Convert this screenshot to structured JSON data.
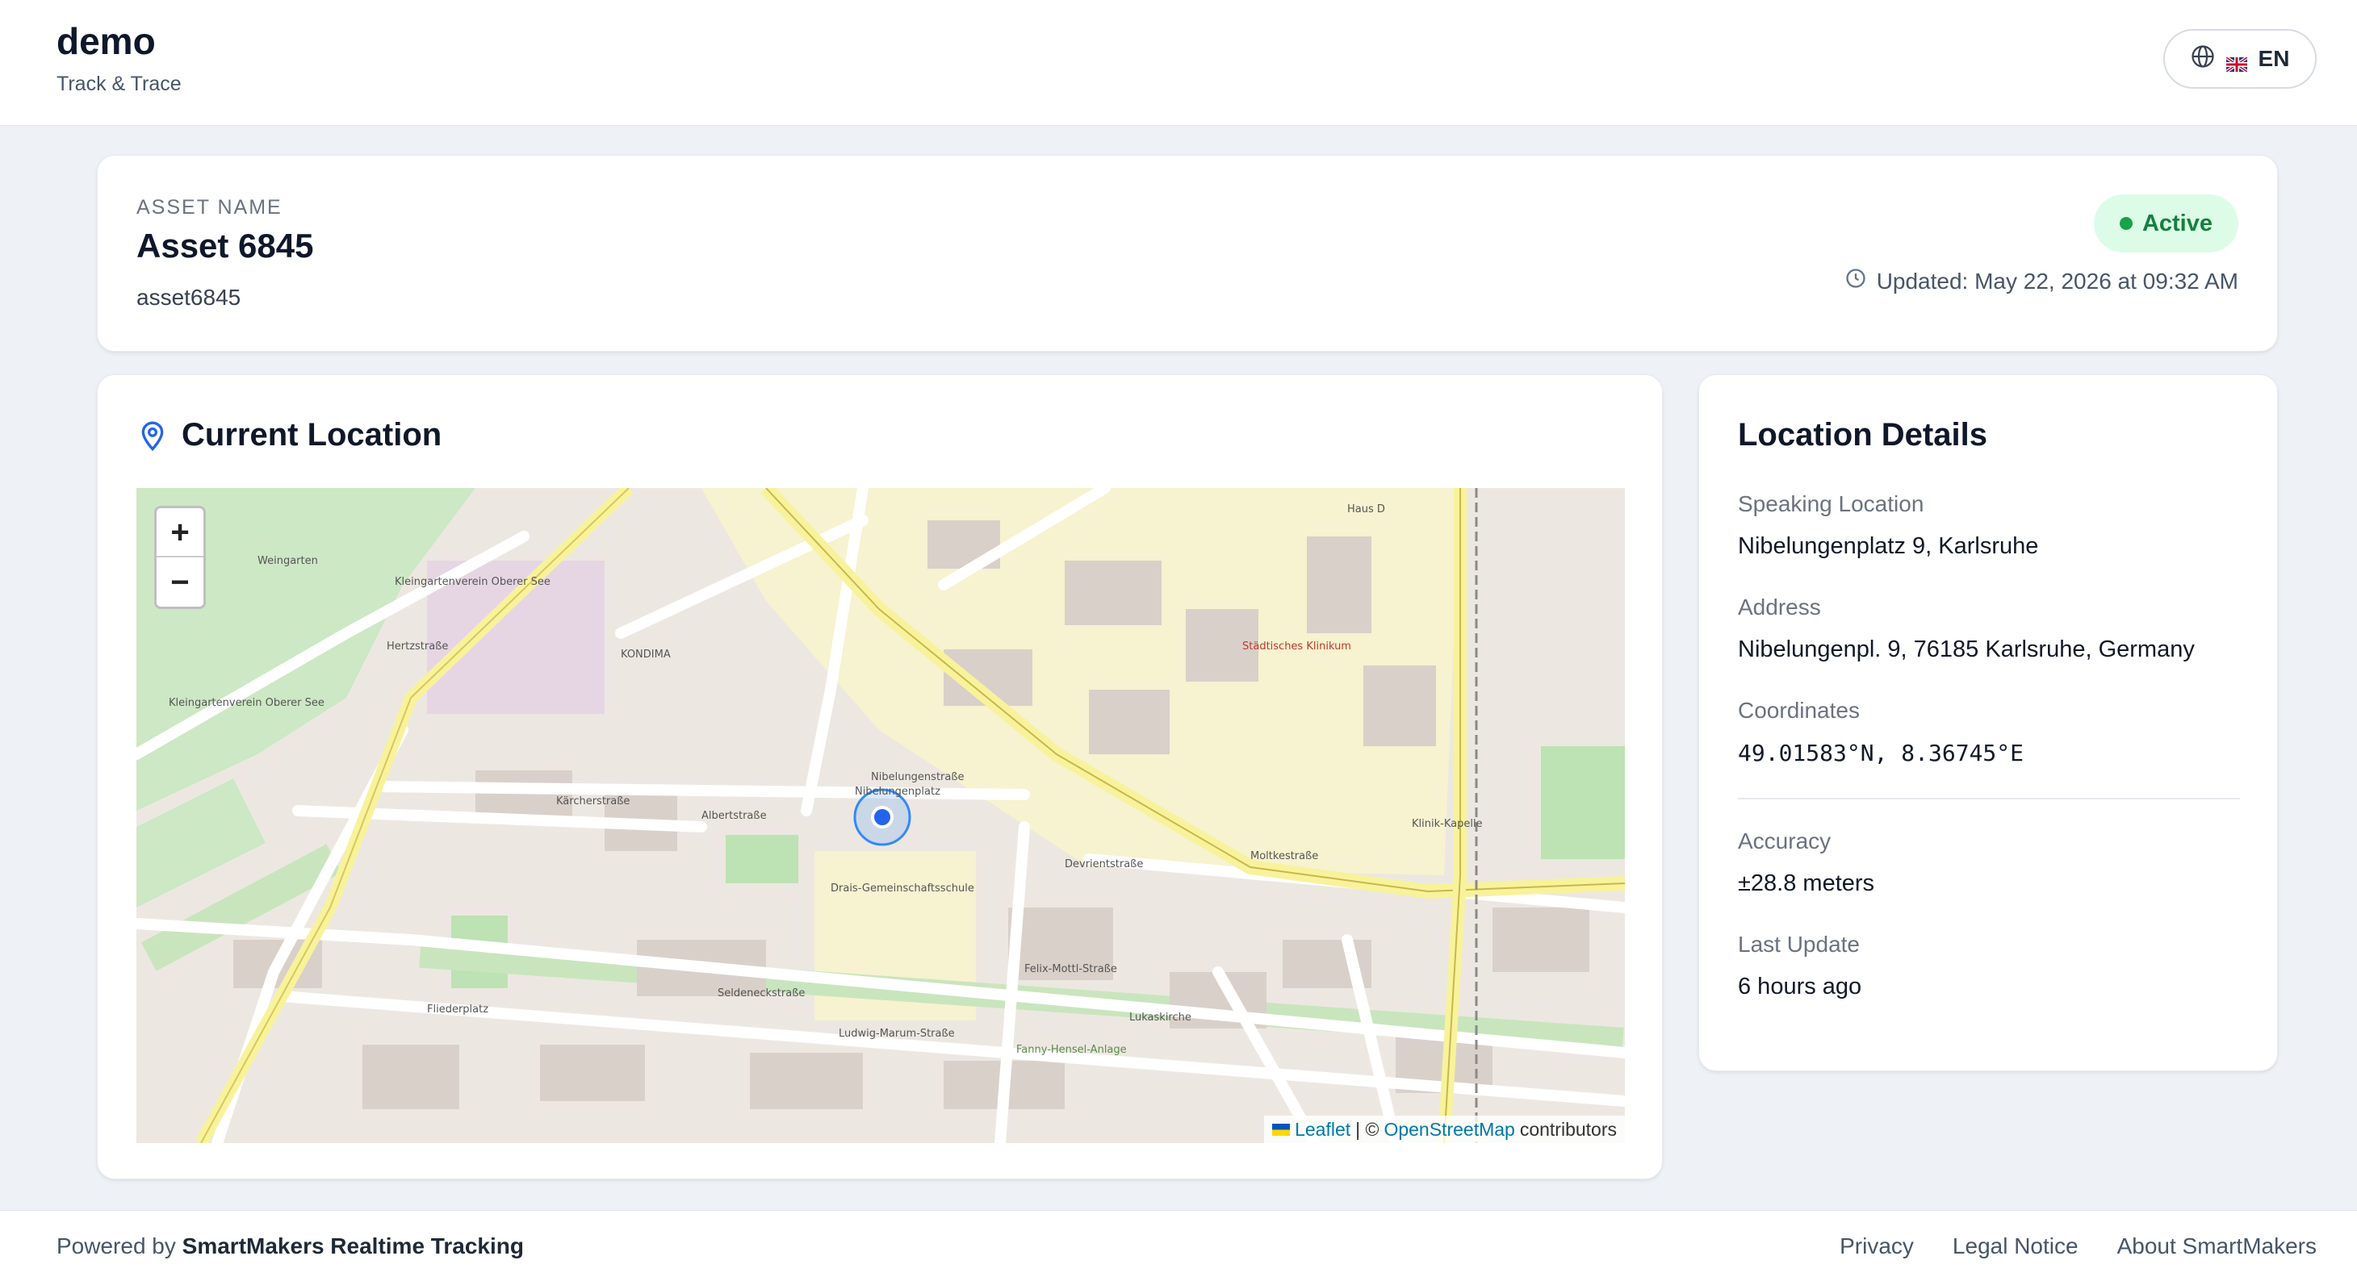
{
  "header": {
    "title": "demo",
    "subtitle": "Track & Trace",
    "language_label": "EN"
  },
  "asset": {
    "section_label": "ASSET NAME",
    "name": "Asset 6845",
    "id": "asset6845",
    "status": "Active",
    "status_color": "#16a34a",
    "updated_text": "Updated: May 22, 2026 at 09:32 AM"
  },
  "map": {
    "title": "Current Location",
    "zoom_in": "+",
    "zoom_out": "−",
    "attribution_leaflet": "Leaflet",
    "attribution_sep": "| ©",
    "attribution_osm": "OpenStreetMap",
    "attribution_suffix": "contributors",
    "labels": [
      "Weingarten",
      "Kleingartenverein Oberer See",
      "Kleingartenverein Oberer See",
      "KONDIMA",
      "Nibelungenstraße",
      "Kärcherstraße",
      "Albertstraße",
      "Nibelungenplatz",
      "Drais-Gemeinschaftsschule",
      "Devrientstraße",
      "Moltkestraße",
      "Seldeneckstraße",
      "Ludwig-Marum-Straße",
      "Fliederplatz",
      "Haus D",
      "Städtisches Klinikum",
      "Lukaskirche",
      "Fanny-Hensel-Anlage",
      "Klinik-Kapelle",
      "Hertzstraße",
      "Felix-Mottl-Straße"
    ]
  },
  "details": {
    "title": "Location Details",
    "speaking_label": "Speaking Location",
    "speaking_value": "Nibelungenplatz 9, Karlsruhe",
    "address_label": "Address",
    "address_value": "Nibelungenpl. 9, 76185 Karlsruhe, Germany",
    "coords_label": "Coordinates",
    "coords_value": "49.01583°N, 8.36745°E",
    "accuracy_label": "Accuracy",
    "accuracy_value": "±28.8 meters",
    "last_update_label": "Last Update",
    "last_update_value": "6 hours ago"
  },
  "footer": {
    "powered_prefix": "Powered by",
    "powered_brand": "SmartMakers Realtime Tracking",
    "links": [
      "Privacy",
      "Legal Notice",
      "About SmartMakers"
    ]
  },
  "colors": {
    "accent": "#2563eb",
    "status_bg": "#dcfce7",
    "status_text": "#15803d"
  },
  "icons": [
    "globe-icon",
    "uk-flag-icon",
    "clock-icon",
    "location-pin-icon",
    "location-marker-icon"
  ]
}
